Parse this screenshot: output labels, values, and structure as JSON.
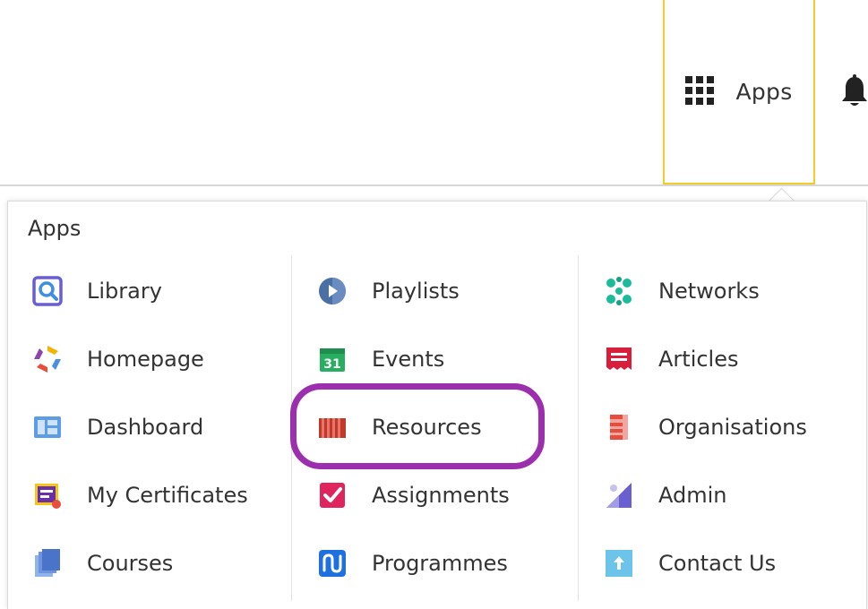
{
  "header": {
    "apps_label": "Apps",
    "apps_icon": "grid-icon",
    "notification_icon": "bell-icon",
    "accent_color": "#f0cc2c"
  },
  "menu": {
    "title": "Apps",
    "columns": [
      [
        {
          "label": "Library",
          "icon": "library-icon"
        },
        {
          "label": "Homepage",
          "icon": "homepage-icon"
        },
        {
          "label": "Dashboard",
          "icon": "dashboard-icon"
        },
        {
          "label": "My Certificates",
          "icon": "certificates-icon"
        },
        {
          "label": "Courses",
          "icon": "courses-icon"
        }
      ],
      [
        {
          "label": "Playlists",
          "icon": "playlists-icon"
        },
        {
          "label": "Events",
          "icon": "events-icon"
        },
        {
          "label": "Resources",
          "icon": "resources-icon"
        },
        {
          "label": "Assignments",
          "icon": "assignments-icon"
        },
        {
          "label": "Programmes",
          "icon": "programmes-icon"
        }
      ],
      [
        {
          "label": "Networks",
          "icon": "networks-icon"
        },
        {
          "label": "Articles",
          "icon": "articles-icon"
        },
        {
          "label": "Organisations",
          "icon": "organisations-icon"
        },
        {
          "label": "Admin",
          "icon": "admin-icon"
        },
        {
          "label": "Contact Us",
          "icon": "contact-icon"
        }
      ]
    ],
    "events_icon_text": "31",
    "highlight_color": "#9b2fae"
  }
}
